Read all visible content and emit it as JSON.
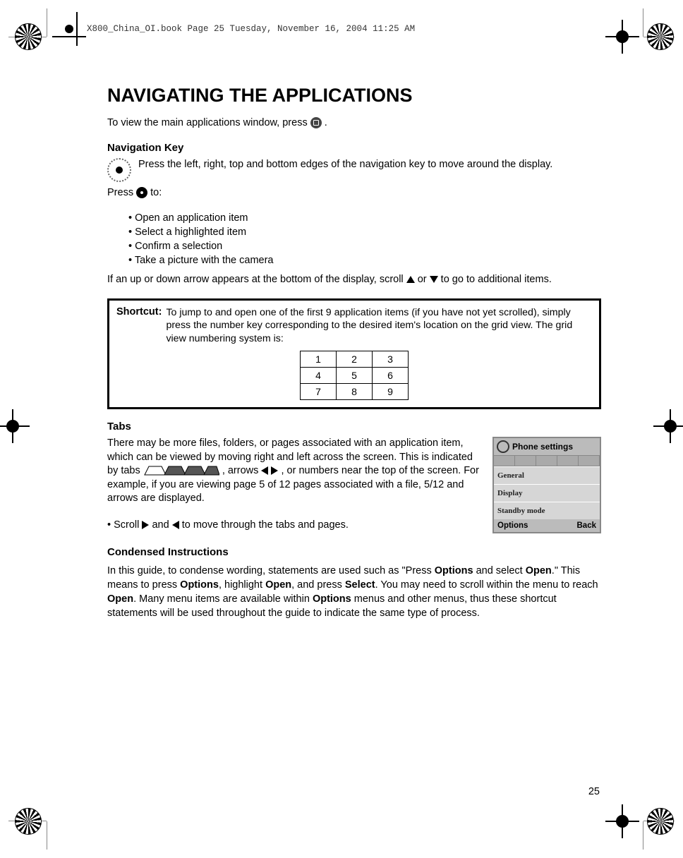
{
  "header": "X800_China_OI.book  Page 25  Tuesday, November 16, 2004  11:25 AM",
  "title": "NAVIGATING THE APPLICATIONS",
  "intro": "To view the main applications window, press ",
  "intro_tail": ".",
  "nav_heading": "Navigation Key",
  "nav_para": "Press the left, right, top and bottom edges of the navigation key to move around the display.",
  "press_to_pre": "Press ",
  "press_to_post": " to:",
  "press_list": {
    "a": "Open an application item",
    "b": "Select a highlighted item",
    "c": "Confirm a selection",
    "d": "Take a picture with the camera"
  },
  "scroll_pre": "If an up or down arrow appears at the bottom of the display, scroll ",
  "scroll_mid": " or ",
  "scroll_post": " to go to additional items.",
  "shortcut_label": "Shortcut:",
  "shortcut_text": "To jump to and open one of the first 9 application items (if you have not yet scrolled), simply press the number key corresponding to the desired item's location on the grid view. The grid view numbering system is:",
  "grid": {
    "r1c1": "1",
    "r1c2": "2",
    "r1c3": "3",
    "r2c1": "4",
    "r2c2": "5",
    "r2c3": "6",
    "r3c1": "7",
    "r3c2": "8",
    "r3c3": "9"
  },
  "tabs_heading": "Tabs",
  "tabs_p1a": "There may be more files, folders, or pages associated with an application item, which can be viewed by moving right and left across the screen. This is indicated by tabs ",
  "tabs_p1b": ", arrows ",
  "tabs_p1c": ", or numbers near the top of the screen. For example, if you are viewing page 5 of 12 pages associated with a file, 5/12 and arrows are displayed.",
  "tabs_scroll_pre": "Scroll ",
  "tabs_scroll_mid": " and ",
  "tabs_scroll_post": " to move through the tabs and pages.",
  "phone": {
    "title": "Phone settings",
    "item1": "General",
    "item2": "Display",
    "item3": "Standby mode",
    "soft_left": "Options",
    "soft_right": "Back"
  },
  "condensed_heading": "Condensed Instructions",
  "condensed": {
    "t0": "In this guide, to condense wording, statements are used such as \"Press ",
    "b1": "Options",
    "t1": " and select ",
    "b2": "Open",
    "t2": ".\" This means to press ",
    "b3": "Options",
    "t3": ", highlight ",
    "b4": "Open",
    "t4": ", and press ",
    "b5": "Select",
    "t5": ". You may need to scroll within the menu to reach ",
    "b6": "Open",
    "t6": ". Many menu items are available within ",
    "b7": "Options",
    "t7": " menus and other menus, thus these shortcut statements will be used throughout the guide to indicate the same type of process."
  },
  "page_number": "25"
}
